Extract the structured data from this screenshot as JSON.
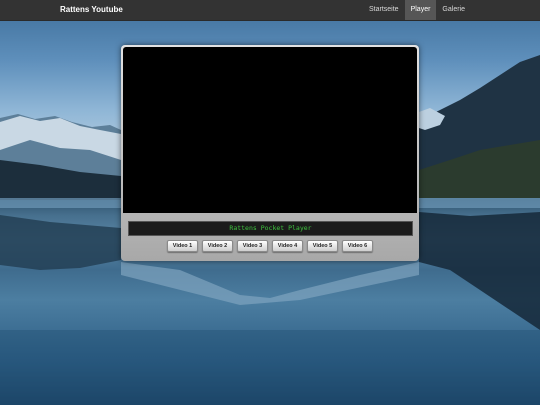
{
  "navbar": {
    "brand": "Rattens Youtube",
    "items": [
      {
        "label": "Startseite",
        "active": false
      },
      {
        "label": "Player",
        "active": true
      },
      {
        "label": "Galerie",
        "active": false
      }
    ]
  },
  "player": {
    "display_text": "Rattens Pocket Player",
    "buttons": [
      "Video 1",
      "Video 2",
      "Video 3",
      "Video 4",
      "Video 5",
      "Video 6"
    ]
  },
  "colors": {
    "navbar_bg": "#333333",
    "nav_active_bg": "#565656",
    "lcd_text": "#3ec23e"
  }
}
